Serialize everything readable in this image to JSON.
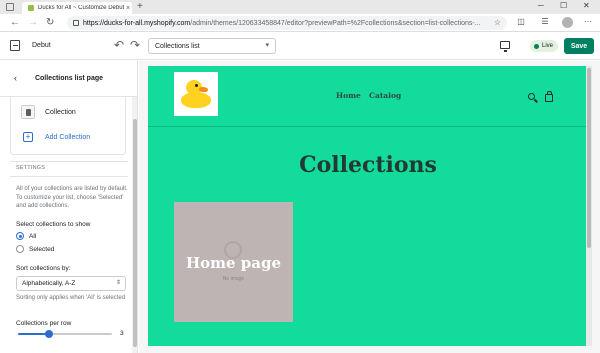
{
  "browser": {
    "tab_title": "Ducks for All ~ Customize Debut",
    "url_host": "https://ducks-for-all.myshopify.com",
    "url_path": "/admin/themes/120633458847/editor?previewPath=%2Fcollections&section=list-collections-..."
  },
  "topbar": {
    "theme_name": "Debut",
    "page_select_value": "Collections list",
    "live_label": "Live",
    "save_label": "Save"
  },
  "sidebar": {
    "title": "Collections list page",
    "block_label": "Collection",
    "add_label": "Add Collection",
    "settings_heading": "SETTINGS",
    "help_text": "All of your collections are listed by default. To customize your list, choose 'Selected' and add collections.",
    "select_label": "Select collections to show",
    "radio_all": "All",
    "radio_selected": "Selected",
    "sort_label": "Sort collections by:",
    "sort_value": "Alphabetically, A-Z",
    "sort_note": "Sorting only applies when 'All' is selected",
    "per_row_label": "Collections per row",
    "per_row_value": "3",
    "per_row_fraction": 0.33
  },
  "preview": {
    "nav_home": "Home",
    "nav_catalog": "Catalog",
    "page_title": "Collections",
    "card_title": "Home page",
    "card_subtitle": "No image",
    "bg_color": "#13db9b"
  }
}
